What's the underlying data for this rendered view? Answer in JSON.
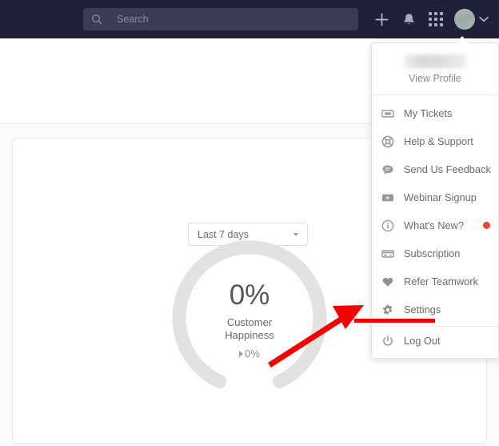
{
  "navbar": {
    "search": {
      "placeholder": "Search",
      "value": "",
      "icon": "search-icon"
    },
    "actions": [
      {
        "name": "add-button",
        "icon": "plus-icon"
      },
      {
        "name": "notifications-button",
        "icon": "bell-icon"
      },
      {
        "name": "app-switcher-button",
        "icon": "grid-apps-icon"
      }
    ],
    "avatar": {
      "name": "user-avatar",
      "icon": "avatar"
    },
    "chevron": {
      "name": "user-menu-chevron",
      "icon": "chevron-down-icon"
    },
    "background_color": "#1f2039",
    "search_background": "#3a3b55"
  },
  "user_menu": {
    "profile": {
      "name_redacted": true,
      "view_profile_label": "View Profile"
    },
    "items": [
      {
        "label": "My Tickets",
        "icon": "ticket-icon",
        "badge": false
      },
      {
        "label": "Help & Support",
        "icon": "lifebuoy-icon",
        "badge": false
      },
      {
        "label": "Send Us Feedback",
        "icon": "speech-bubble-icon",
        "badge": false
      },
      {
        "label": "Webinar Signup",
        "icon": "video-play-icon",
        "badge": false
      },
      {
        "label": "What's New?",
        "icon": "info-circle-icon",
        "badge": true
      },
      {
        "label": "Subscription",
        "icon": "credit-card-icon",
        "badge": false
      },
      {
        "label": "Refer Teamwork",
        "icon": "heart-icon",
        "badge": false
      },
      {
        "label": "Settings",
        "icon": "gear-icon",
        "badge": false
      },
      {
        "label": "Log Out",
        "icon": "power-icon",
        "badge": false
      }
    ],
    "badge_color": "#e8453c"
  },
  "dashboard": {
    "range_selector": {
      "selected": "Last 7 days",
      "icon": "chevron-down-icon"
    }
  },
  "chart_data": {
    "type": "gauge",
    "title": "Customer Happiness",
    "value": 0,
    "value_label": "0%",
    "unit": "%",
    "range": [
      0,
      100
    ],
    "trend": {
      "direction": "flat",
      "label": "0%",
      "icon": "triangle-right-icon"
    },
    "track_color": "#e2e2e2",
    "fill_color": "#e2e2e2",
    "legend": "none",
    "grid": false
  },
  "annotations": {
    "arrow": {
      "color": "#f40000",
      "points_to": "Settings",
      "from": [
        337,
        455
      ],
      "to": [
        450,
        383
      ]
    },
    "underline": {
      "color": "#f40000",
      "target": "Settings"
    }
  }
}
